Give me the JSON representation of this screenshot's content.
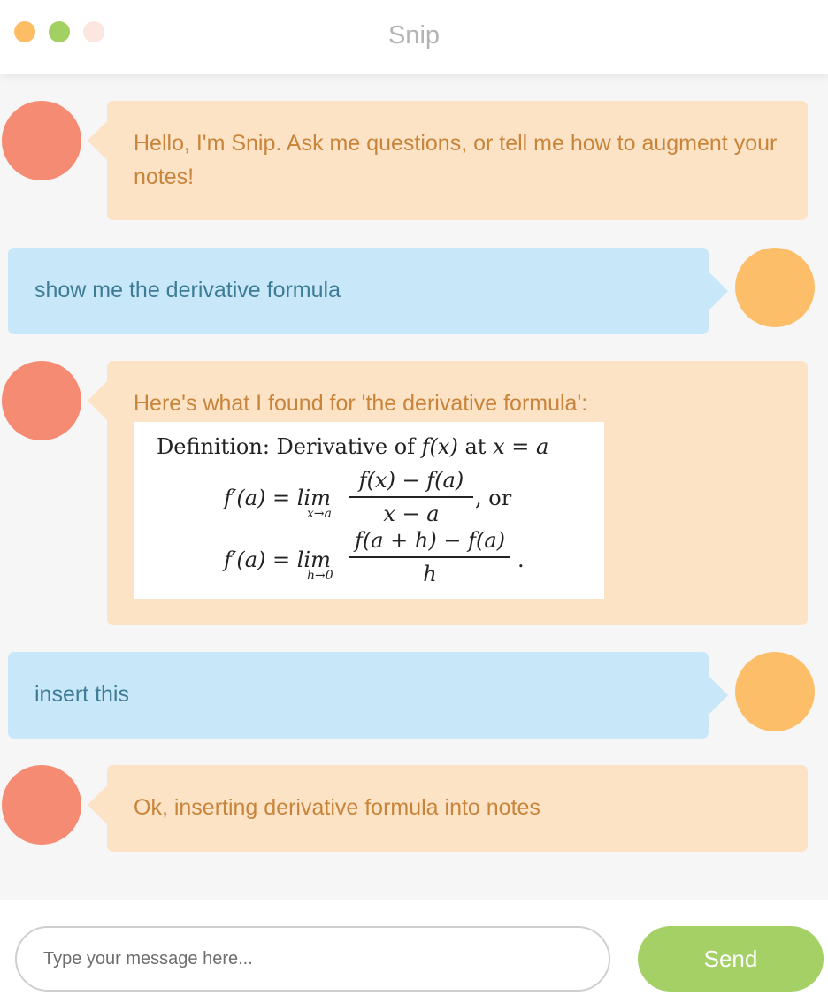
{
  "app": {
    "title": "Snip"
  },
  "messages": [
    {
      "from": "bot",
      "text": "Hello, I'm Snip. Ask me questions, or tell me how to augment your notes!"
    },
    {
      "from": "user",
      "text": "show me the derivative formula"
    },
    {
      "from": "bot",
      "text": "Here's what I found for 'the derivative formula':",
      "formula": {
        "heading_word": "Definition: Derivative of",
        "heading_fx": "f(x)",
        "heading_at": "at",
        "heading_eq": "x = a",
        "line1_lhs": "f′(a) = lim",
        "line1_sub": "x→a",
        "line1_num": "f(x) − f(a)",
        "line1_den": "x − a",
        "line1_tail": ",  or",
        "line2_lhs": "f′(a) = lim",
        "line2_sub": "h→0",
        "line2_num": "f(a + h) − f(a)",
        "line2_den": "h",
        "line2_tail": "."
      }
    },
    {
      "from": "user",
      "text": "insert this"
    },
    {
      "from": "bot",
      "text": "Ok, inserting derivative formula into notes"
    }
  ],
  "composer": {
    "placeholder": "Type your message here...",
    "send_label": "Send"
  },
  "colors": {
    "bot_bubble": "#fde3c6",
    "user_bubble": "#c8e8fa",
    "send": "#a4d066"
  }
}
